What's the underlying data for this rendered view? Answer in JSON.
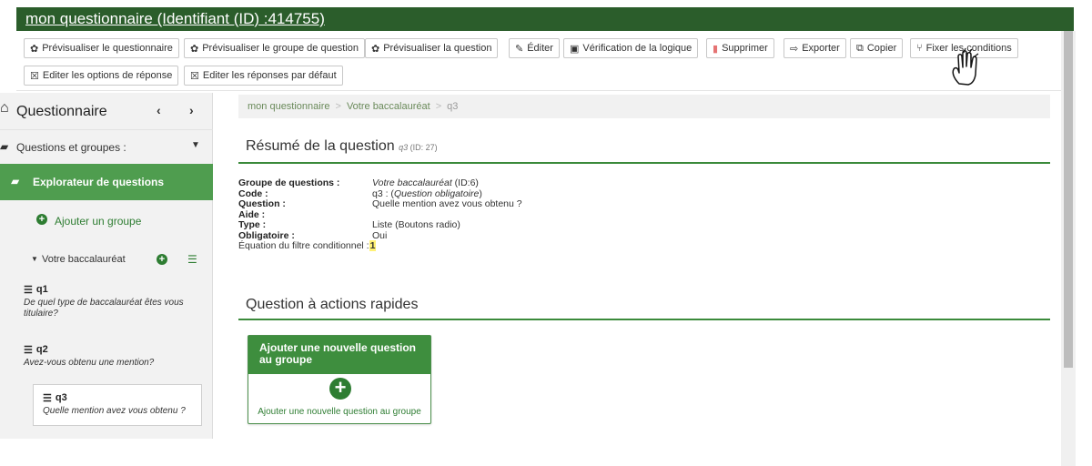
{
  "title": "mon questionnaire (Identifiant (ID) :414755)",
  "toolbar": {
    "preview_survey": "Prévisualiser le questionnaire",
    "preview_group": "Prévisualiser le groupe de question",
    "preview_question": "Prévisualiser la question",
    "edit": "Éditer",
    "logic_check": "Vérification de la logique",
    "delete": "Supprimer",
    "export": "Exporter",
    "copy": "Copier",
    "conditions": "Fixer les conditions",
    "answer_options": "Editer les options de réponse",
    "default_answers": "Editer les réponses par défaut"
  },
  "sidebar": {
    "header": "Questionnaire",
    "questions_groups": "Questions et groupes :",
    "explorer": "Explorateur de questions",
    "add_group": "Ajouter un groupe",
    "group_name": "Votre baccalauréat",
    "questions": [
      {
        "code": "q1",
        "text": "De quel type de baccalauréat êtes vous titulaire?"
      },
      {
        "code": "q2",
        "text": "Avez-vous obtenu une mention?"
      },
      {
        "code": "q3",
        "text": "Quelle mention avez vous obtenu ?"
      }
    ]
  },
  "breadcrumb": {
    "survey": "mon questionnaire",
    "group": "Votre baccalauréat",
    "question": "q3"
  },
  "summary": {
    "heading": "Résumé de la question",
    "code_small": "q3",
    "id_small": "(ID: 27)",
    "rows": {
      "group_label": "Groupe de questions :",
      "group_value": "Votre baccalauréat",
      "group_id": " (ID:6)",
      "code_label": "Code :",
      "code_value": "q3 : (",
      "code_mandatory": "Question obligatoire",
      "code_close": ")",
      "question_label": "Question :",
      "question_value": "Quelle mention avez vous obtenu ?",
      "help_label": "Aide :",
      "type_label": "Type :",
      "type_value": "Liste (Boutons radio)",
      "mandatory_label": "Obligatoire :",
      "mandatory_value": "Oui",
      "equation_label": "Équation du filtre conditionnel :",
      "equation_value": "1"
    }
  },
  "quick_actions": {
    "heading": "Question à actions rapides",
    "card_title": "Ajouter une nouvelle question au groupe",
    "card_footer": "Ajouter une nouvelle question au groupe"
  }
}
